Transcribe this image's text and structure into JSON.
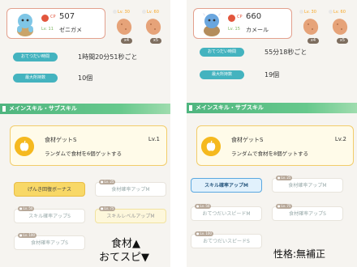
{
  "left": {
    "cp_label": "CP",
    "cp": "507",
    "level": "Lv. 11",
    "name": "ゼニガメ",
    "items": [
      {
        "lv": "Lv. 30",
        "count": "x4"
      },
      {
        "lv": "Lv. 60",
        "count": "x5"
      }
    ],
    "stats": [
      {
        "label": "おてつだい時間",
        "value": "1時間20分51秒ごと"
      },
      {
        "label": "最大所持数",
        "value": "10個"
      }
    ],
    "section_title": "メインスキル・サブスキル",
    "skill": {
      "name": "食材ゲットS",
      "lv": "Lv.1",
      "desc": "ランダムで食材を6個ゲットする"
    },
    "subskills": [
      {
        "lv": "",
        "label": "げんき回復ボーナス"
      },
      {
        "lv": "Lv. 25",
        "label": "食材確率アップM"
      },
      {
        "lv": "Lv. 50",
        "label": "スキル確率アップS"
      },
      {
        "lv": "Lv. 75",
        "label": "スキルレベルアップM"
      },
      {
        "lv": "Lv. 100",
        "label": "食材確率アップS"
      }
    ]
  },
  "right": {
    "cp_label": "CP",
    "cp": "660",
    "level": "Lv. 15",
    "name": "カメール",
    "items": [
      {
        "lv": "Lv. 30",
        "count": "x4"
      },
      {
        "lv": "Lv. 60",
        "count": "x5"
      }
    ],
    "stats": [
      {
        "label": "おてつだい時間",
        "value": "55分18秒ごと"
      },
      {
        "label": "最大所持数",
        "value": "19個"
      }
    ],
    "section_title": "メインスキル・サブスキル",
    "skill": {
      "name": "食材ゲットS",
      "lv": "Lv.2",
      "desc": "ランダムで食材を8個ゲットする"
    },
    "subskills": [
      {
        "lv": "",
        "label": "スキル確率アップM"
      },
      {
        "lv": "Lv. 25",
        "label": "食材確率アップM"
      },
      {
        "lv": "Lv. 50",
        "label": "おてつだいスピードM"
      },
      {
        "lv": "Lv. 75",
        "label": "食材確率アップS"
      },
      {
        "lv": "Lv. 100",
        "label": "おてつだいスピードS"
      }
    ]
  },
  "notes": {
    "line1": "食材▲",
    "line2": "おてスピ▼",
    "line3": "性格:無補正"
  },
  "colors": {
    "accent_green": "#4fb57f",
    "stat_teal": "#44b3bf",
    "skill_gold": "#f5b91f",
    "cp_red": "#e2563d"
  }
}
